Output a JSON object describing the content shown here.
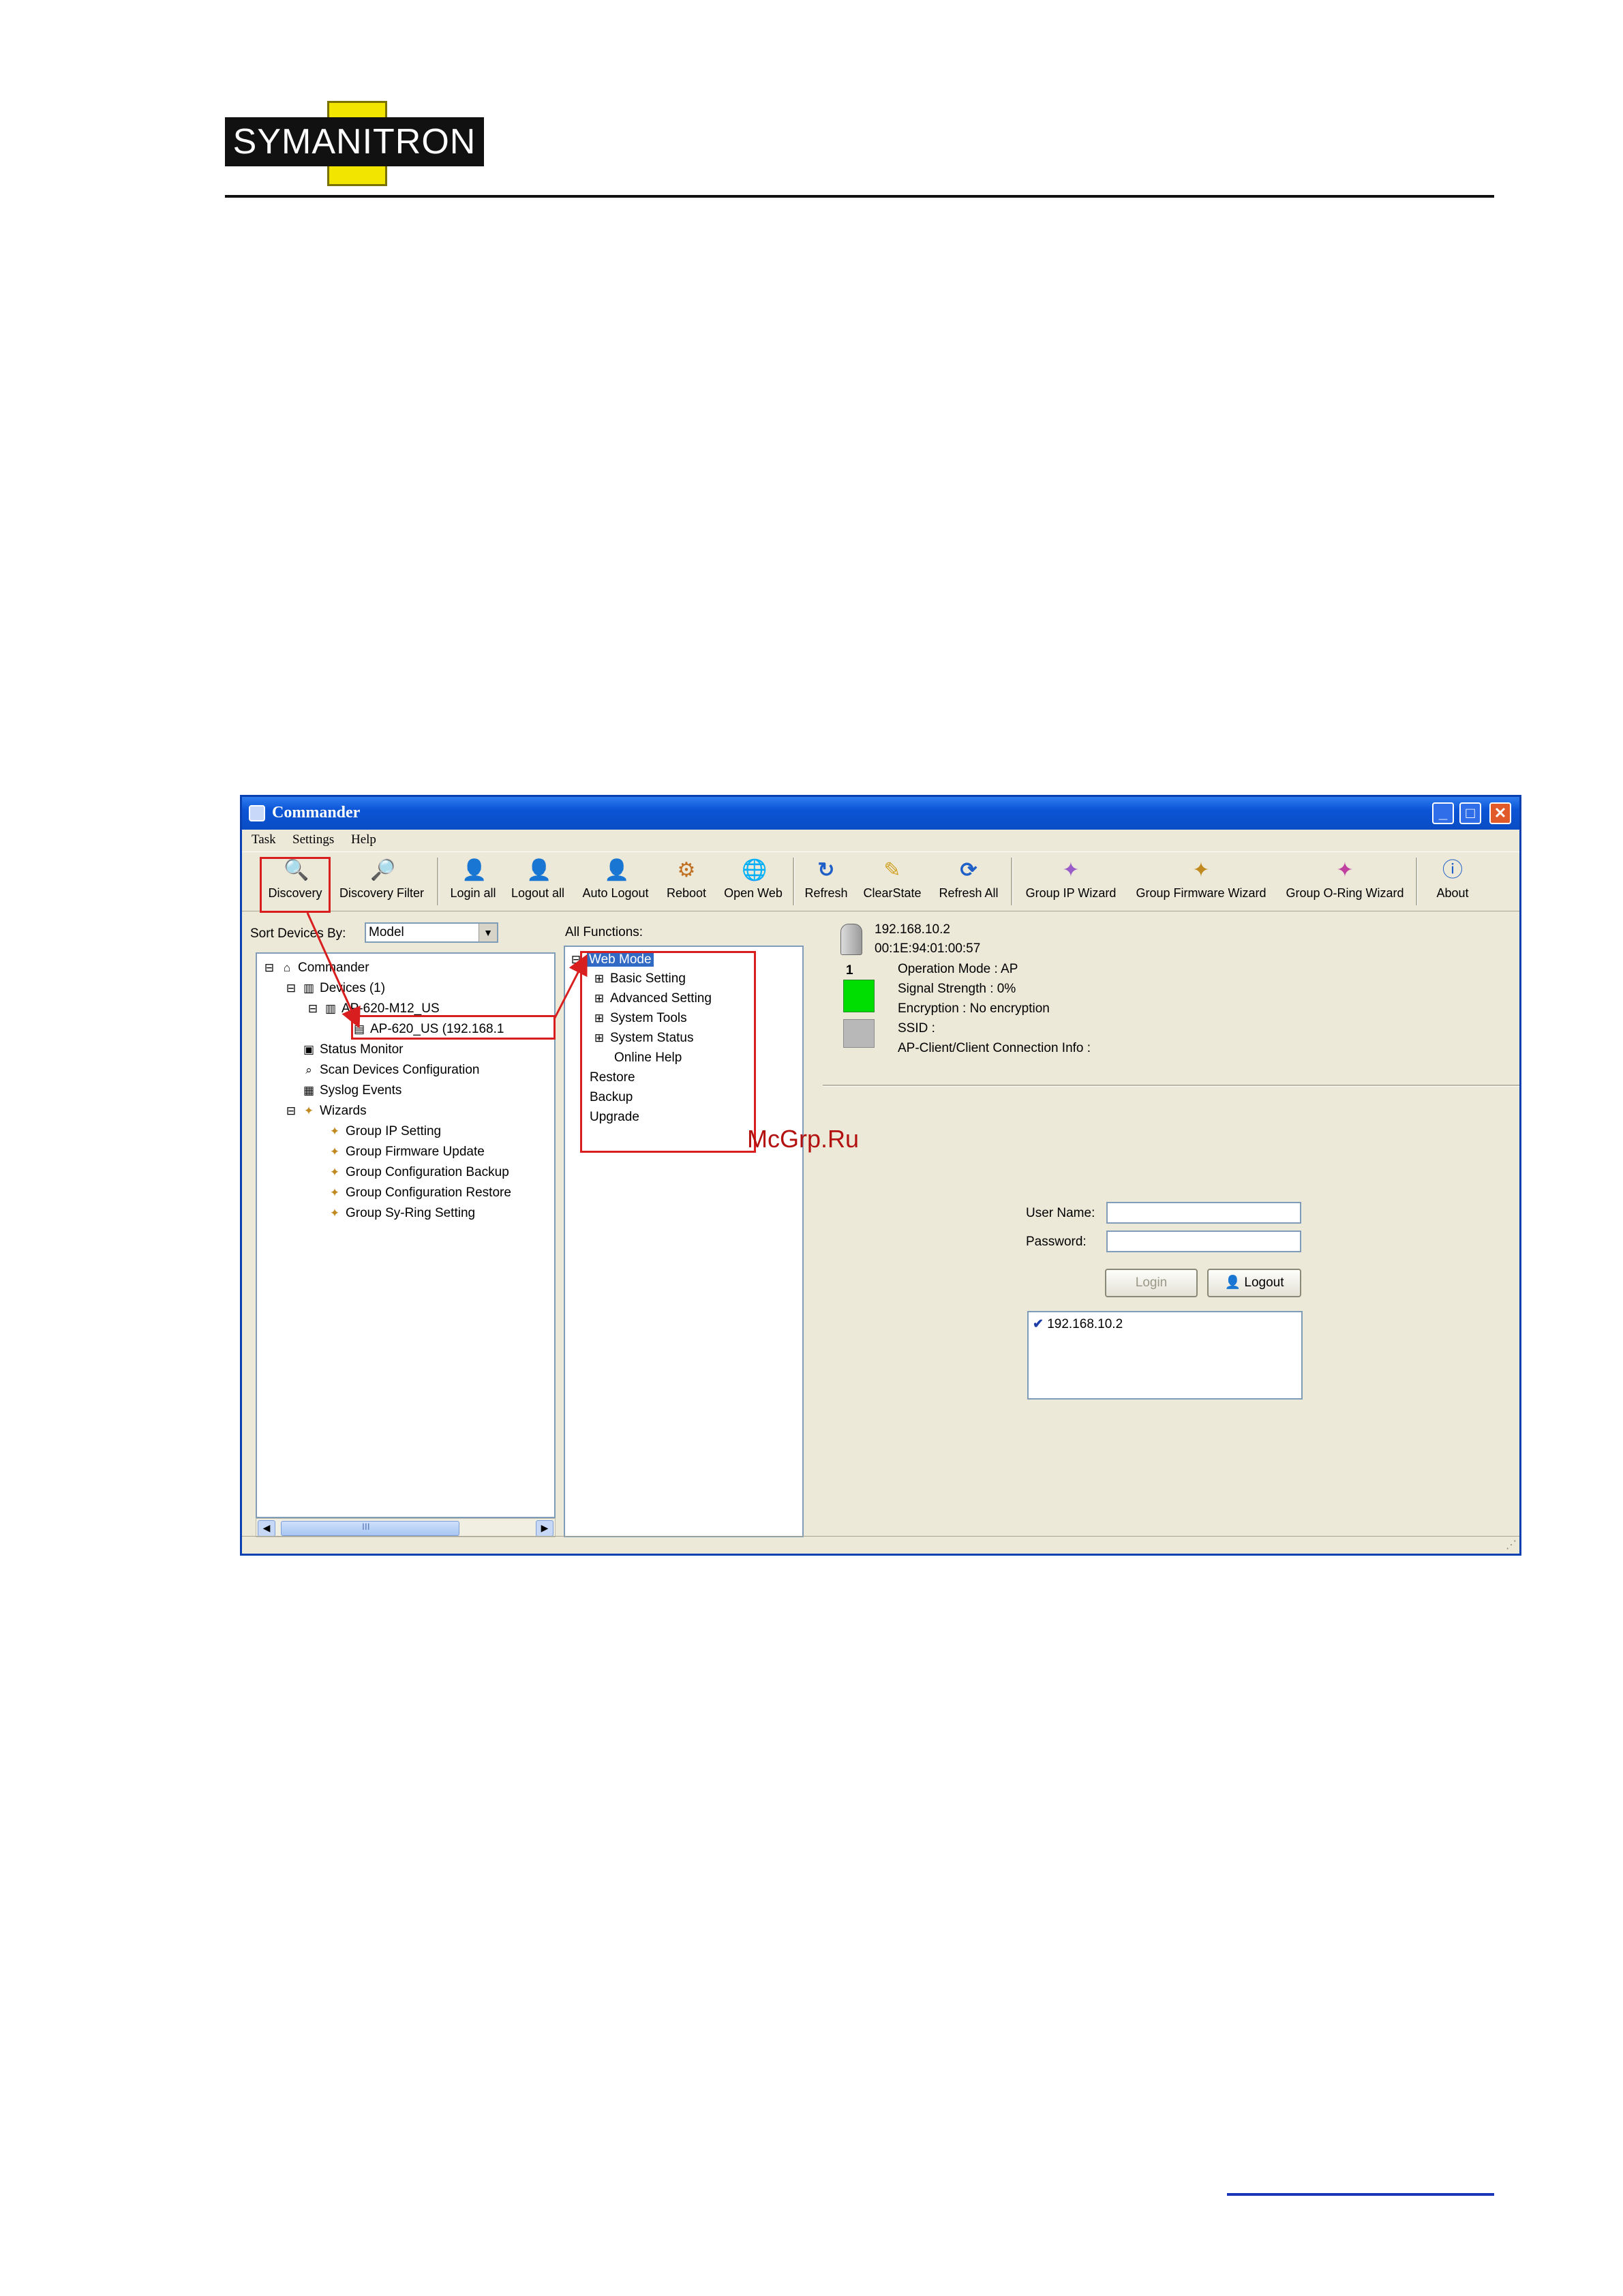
{
  "header": {
    "logo_text": "SYMANITRON"
  },
  "watermark": "McGrp.Ru",
  "window": {
    "title": "Commander",
    "controls": {
      "minimize": "_",
      "maximize": "□",
      "close": "✕"
    },
    "menu": [
      "Task",
      "Settings",
      "Help"
    ],
    "toolbar": [
      {
        "label": "Discovery",
        "icon": "magnifier-icon"
      },
      {
        "label": "Discovery Filter",
        "icon": "filter-magnifier-icon"
      },
      {
        "label": "Login all",
        "icon": "user-icon"
      },
      {
        "label": "Logout all",
        "icon": "user-grey-icon"
      },
      {
        "label": "Auto Logout",
        "icon": "user-green-icon"
      },
      {
        "label": "Reboot",
        "icon": "reboot-icon"
      },
      {
        "label": "Open Web",
        "icon": "web-icon"
      },
      {
        "label": "Refresh",
        "icon": "refresh-icon"
      },
      {
        "label": "ClearState",
        "icon": "clear-icon"
      },
      {
        "label": "Refresh All",
        "icon": "refresh-all-icon"
      },
      {
        "label": "Group IP Wizard",
        "icon": "wand-icon"
      },
      {
        "label": "Group Firmware Wizard",
        "icon": "wand-icon"
      },
      {
        "label": "Group O-Ring Wizard",
        "icon": "wand-icon"
      },
      {
        "label": "About",
        "icon": "info-icon"
      }
    ],
    "left": {
      "sort_label": "Sort Devices By:",
      "sort_value": "Model",
      "tree": [
        "Commander",
        "Devices (1)",
        "AP-620-M12_US",
        "AP-620_US (192.168.1",
        "Status Monitor",
        "Scan Devices Configuration",
        "Syslog Events",
        "Wizards",
        "Group IP Setting",
        "Group Firmware Update",
        "Group Configuration Backup",
        "Group Configuration Restore",
        "Group Sy-Ring Setting"
      ],
      "scroll_mid": "III"
    },
    "middle": {
      "label": "All Functions:",
      "tree": [
        "Web Mode",
        "Basic Setting",
        "Advanced Setting",
        "System Tools",
        "System Status",
        "Online Help",
        "Restore",
        "Backup",
        "Upgrade"
      ]
    },
    "right": {
      "ip": "192.168.10.2",
      "mac": "00:1E:94:01:00:57",
      "port_number": "1",
      "operation_mode": "Operation Mode :  AP",
      "signal_strength": "Signal Strength :  0%",
      "encryption": "Encryption :  No encryption",
      "ssid": "SSID :",
      "connection_info": "AP-Client/Client Connection Info :",
      "username_label": "User Name:",
      "password_label": "Password:",
      "login_button": "Login",
      "logout_button": "Logout",
      "device_list": [
        "192.168.10.2"
      ]
    },
    "colors": {
      "titlebar": "#0b55d6",
      "window_bg": "#ece9d8",
      "annotation": "#d81e1e",
      "port_active": "#00dd00"
    }
  }
}
